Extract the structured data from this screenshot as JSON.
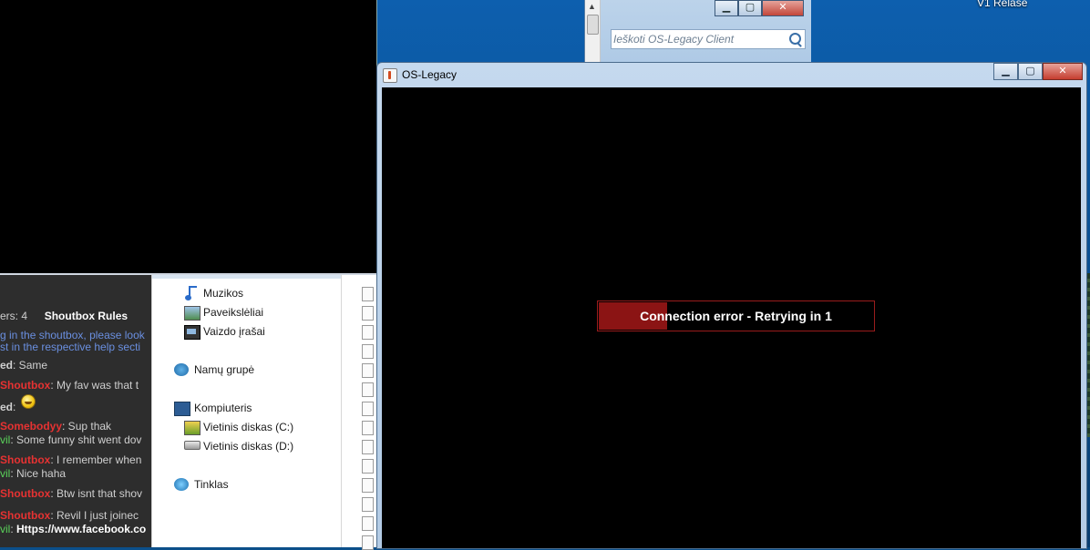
{
  "desktop": {
    "label": "V1 Relase"
  },
  "explorer": {
    "search_placeholder": "Ieškoti OS-Legacy Client",
    "controls": {
      "minimize": "▁",
      "maximize": "▢",
      "close": "✕"
    }
  },
  "shoutbox": {
    "header_prefix": "ers: 4",
    "header_rules": "Shoutbox Rules",
    "notice_line1": "g in the shoutbox, please look",
    "notice_line2": "st in the respective help secti",
    "messages": [
      {
        "name": "ed",
        "text": ": Same"
      },
      {
        "name": "Shoutbox",
        "text": ": My fav was that t"
      },
      {
        "name": "ed",
        "text": ":"
      },
      {
        "name": "Somebodyy",
        "text": ": Sup thak"
      },
      {
        "name": "vil",
        "text": ": Some funny shit went dov"
      },
      {
        "name": "Shoutbox",
        "text": ": I remember when"
      },
      {
        "name": "vil",
        "text": ": Nice haha"
      },
      {
        "name": "Shoutbox",
        "text": ": Btw isnt that shov"
      },
      {
        "name": "Shoutbox",
        "text": ": Revil I just joinec"
      },
      {
        "name": "vil",
        "text": ": ",
        "link": "Https://www.facebook.co"
      }
    ]
  },
  "navpane": {
    "items": [
      {
        "label": "Muzikos",
        "icon": "music-icon"
      },
      {
        "label": "Paveikslėliai",
        "icon": "pictures-icon"
      },
      {
        "label": "Vaizdo įrašai",
        "icon": "video-icon"
      },
      {
        "label": "Namų grupė",
        "icon": "homegroup-icon"
      },
      {
        "label": "Kompiuteris",
        "icon": "computer-icon"
      },
      {
        "label": "Vietinis diskas (C:)",
        "icon": "drive-c-icon"
      },
      {
        "label": "Vietinis diskas (D:)",
        "icon": "drive-d-icon"
      },
      {
        "label": "Tinklas",
        "icon": "network-icon"
      }
    ]
  },
  "os_window": {
    "title": "OS-Legacy",
    "controls": {
      "minimize": "▁",
      "maximize": "▢",
      "close": "✕"
    },
    "status_text": "Connection error - Retrying in 1",
    "progress_fraction": 0.25,
    "colors": {
      "progress_fill": "#8b1414",
      "progress_border": "#9a1c1c"
    }
  }
}
